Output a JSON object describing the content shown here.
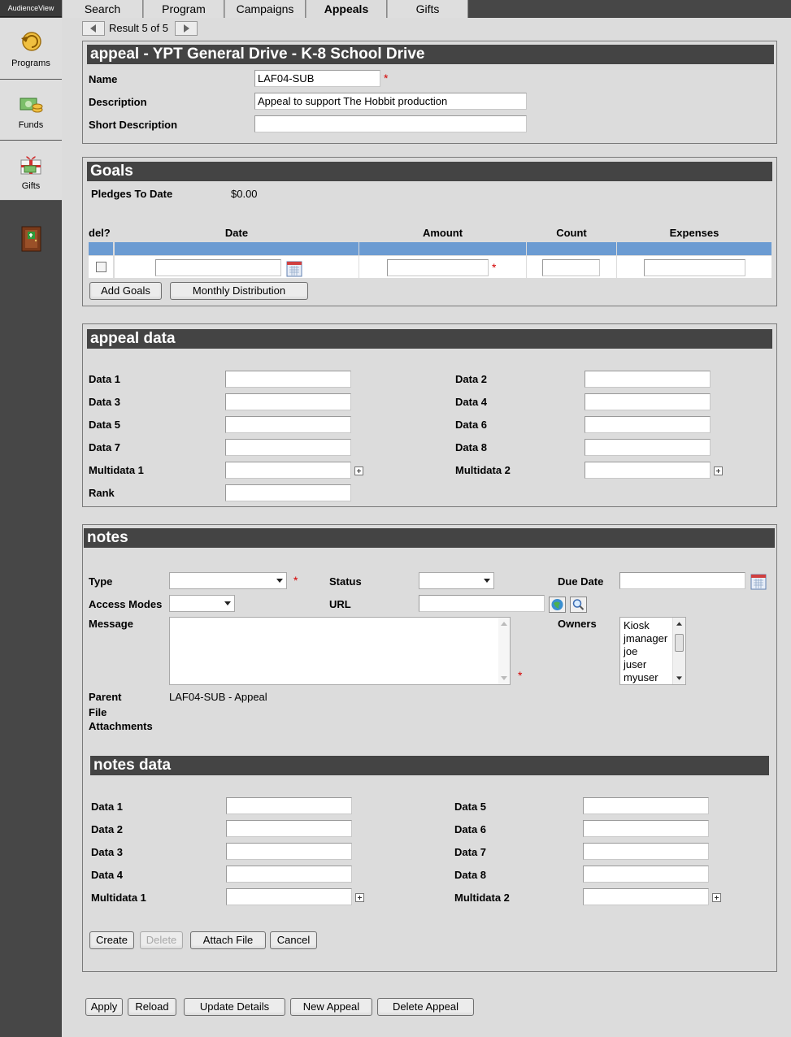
{
  "app": {
    "title": "AudienceView"
  },
  "sidebar": {
    "items": [
      {
        "label": "Programs",
        "icon": "programs-icon"
      },
      {
        "label": "Funds",
        "icon": "funds-icon"
      },
      {
        "label": "Gifts",
        "icon": "gifts-icon"
      }
    ],
    "exit_icon": "exit-door-icon"
  },
  "tabs": [
    {
      "label": "Search"
    },
    {
      "label": "Program"
    },
    {
      "label": "Campaigns"
    },
    {
      "label": "Appeals",
      "active": true
    },
    {
      "label": "Gifts"
    }
  ],
  "result_nav": {
    "text": "Result 5 of 5"
  },
  "appeal": {
    "header": "appeal - YPT General Drive - K-8 School Drive",
    "name_label": "Name",
    "name_value": "LAF04-SUB",
    "description_label": "Description",
    "description_value": "Appeal to support The Hobbit production",
    "short_description_label": "Short Description",
    "short_description_value": "",
    "required_mark": "*"
  },
  "goals": {
    "header": "Goals",
    "pledges_label": "Pledges To Date",
    "pledges_value": "$0.00",
    "columns": [
      "del?",
      "Date",
      "Amount",
      "Count",
      "Expenses"
    ],
    "add_goals_button": "Add Goals",
    "monthly_distribution_button": "Monthly Distribution"
  },
  "appeal_data": {
    "header": "appeal data",
    "left_fields": [
      "Data 1",
      "Data 3",
      "Data 5",
      "Data 7",
      "Multidata 1",
      "Rank"
    ],
    "right_fields": [
      "Data 2",
      "Data 4",
      "Data 6",
      "Data 8",
      "Multidata 2"
    ]
  },
  "notes": {
    "header": "notes",
    "type_label": "Type",
    "status_label": "Status",
    "due_date_label": "Due Date",
    "access_modes_label": "Access Modes",
    "url_label": "URL",
    "message_label": "Message",
    "owners_label": "Owners",
    "owners": [
      "Kiosk",
      "jmanager",
      "joe",
      "juser",
      "myuser"
    ],
    "parent_label": "Parent",
    "parent_value": "LAF04-SUB - Appeal",
    "file_label_1": "File",
    "file_label_2": "Attachments",
    "buttons": {
      "create": "Create",
      "delete": "Delete",
      "attach_file": "Attach File",
      "cancel": "Cancel"
    }
  },
  "notes_data": {
    "header": "notes data",
    "left_fields": [
      "Data 1",
      "Data 2",
      "Data 3",
      "Data 4",
      "Multidata 1"
    ],
    "right_fields": [
      "Data 5",
      "Data 6",
      "Data 7",
      "Data 8",
      "Multidata 2"
    ]
  },
  "footer_buttons": {
    "apply": "Apply",
    "reload": "Reload",
    "update_details": "Update Details",
    "new_appeal": "New Appeal",
    "delete_appeal": "Delete Appeal"
  },
  "colors": {
    "header_bg": "#444444",
    "sidebar_bg": "#474747",
    "table_bar": "#6b9bd2",
    "required": "#d40000"
  }
}
